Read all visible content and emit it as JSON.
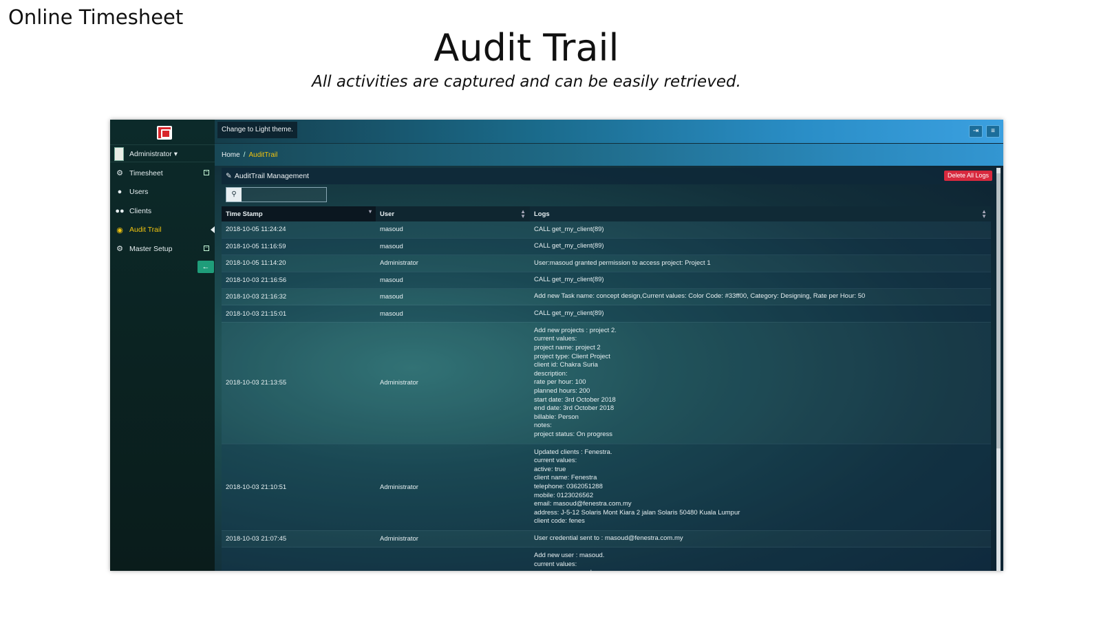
{
  "slide": {
    "header": "Online Timesheet",
    "title": "Audit Trail",
    "subtitle": "All activities are captured and can be easily retrieved."
  },
  "topbar": {
    "theme_button": "Change to Light theme.",
    "logout_icon": "logout-icon",
    "menu_icon": "menu-icon"
  },
  "sidebar": {
    "user": "Administrator ▾",
    "avatar_alt": "me",
    "items": [
      {
        "label": "Timesheet",
        "icon": "gears-icon"
      },
      {
        "label": "Users",
        "icon": "user-icon"
      },
      {
        "label": "Clients",
        "icon": "users-icon"
      },
      {
        "label": "Audit Trail",
        "icon": "eye-icon",
        "active": true
      },
      {
        "label": "Master Setup",
        "icon": "gears-icon"
      }
    ]
  },
  "breadcrumb": {
    "home": "Home",
    "separator": "/",
    "current": "AuditTrail"
  },
  "panel": {
    "title": "AuditTrail Management",
    "delete_button": "Delete All Logs",
    "search_placeholder": ""
  },
  "table": {
    "headers": [
      "Time Stamp",
      "User",
      "Logs"
    ],
    "rows": [
      {
        "ts": "2018-10-05 11:24:24",
        "user": "masoud",
        "logs": [
          "CALL get_my_client(89)"
        ]
      },
      {
        "ts": "2018-10-05 11:16:59",
        "user": "masoud",
        "logs": [
          "CALL get_my_client(89)"
        ]
      },
      {
        "ts": "2018-10-05 11:14:20",
        "user": "Administrator",
        "logs": [
          "User:masoud granted permission to access project: Project 1"
        ]
      },
      {
        "ts": "2018-10-03 21:16:56",
        "user": "masoud",
        "logs": [
          "CALL get_my_client(89)"
        ]
      },
      {
        "ts": "2018-10-03 21:16:32",
        "user": "masoud",
        "logs": [
          "Add new Task name: concept design,Current values: Color Code: #33ff00, Category: Designing, Rate per Hour: 50"
        ]
      },
      {
        "ts": "2018-10-03 21:15:01",
        "user": "masoud",
        "logs": [
          "CALL get_my_client(89)"
        ]
      },
      {
        "ts": "2018-10-03 21:13:55",
        "user": "Administrator",
        "logs": [
          "Add new projects : project 2.",
          "current values:",
          "project name: project 2",
          "project type: Client Project",
          "client id: Chakra Suria",
          "description:",
          "rate per hour: 100",
          "planned hours: 200",
          "start date: 3rd October 2018",
          "end date: 3rd October 2018",
          "billable: Person",
          "notes:",
          "project status: On progress"
        ]
      },
      {
        "ts": "2018-10-03 21:10:51",
        "user": "Administrator",
        "logs": [
          "Updated clients : Fenestra.",
          "current values:",
          "active: true",
          "client name: Fenestra",
          "telephone: 0362051288",
          "mobile: 0123026562",
          "email: masoud@fenestra.com.my",
          "address: J-5-12 Solaris Mont Kiara 2 jalan Solaris 50480 Kuala Lumpur",
          "client code: fenes"
        ]
      },
      {
        "ts": "2018-10-03 21:07:45",
        "user": "Administrator",
        "logs": [
          "User credential sent to : masoud@fenestra.com.my"
        ]
      },
      {
        "ts": "",
        "user": "",
        "logs": [
          "Add new user : masoud.",
          "current values:",
          "user name: masoud"
        ]
      }
    ]
  }
}
